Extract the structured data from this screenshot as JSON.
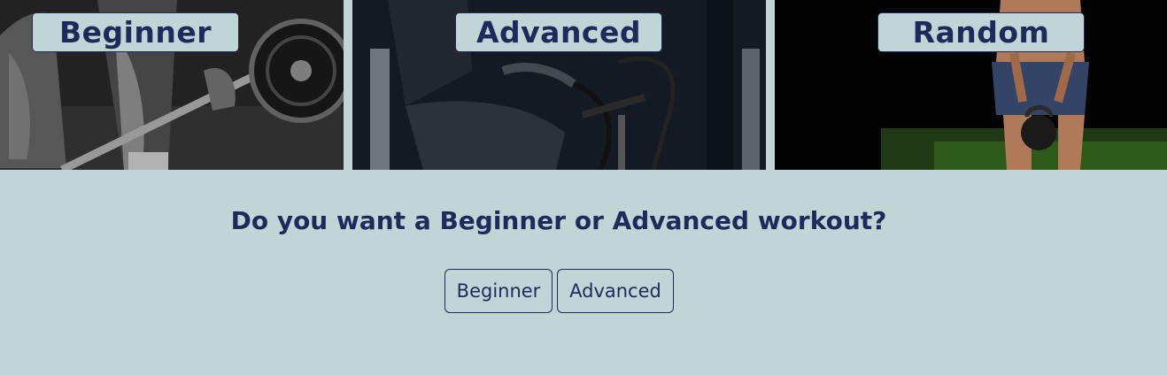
{
  "panels": [
    {
      "label": "Beginner",
      "image": "barbell-deadlift-photo"
    },
    {
      "label": "Advanced",
      "image": "air-bike-photo"
    },
    {
      "label": "Random",
      "image": "kettlebell-swing-photo"
    }
  ],
  "question": "Do you want a Beginner or Advanced workout?",
  "choices": {
    "beginner_label": "Beginner",
    "advanced_label": "Advanced"
  },
  "colors": {
    "background": "#c1d4d6",
    "text": "#1e2a5c"
  }
}
